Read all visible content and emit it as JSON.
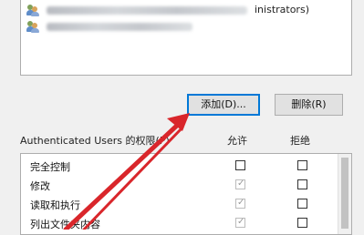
{
  "user_list": {
    "rows": [
      {
        "suffix": "inistrators)"
      },
      {
        "suffix": ""
      }
    ]
  },
  "buttons": {
    "add": "添加(D)...",
    "remove": "删除(R)"
  },
  "permissions": {
    "header_label": "Authenticated Users 的权限(P)",
    "allow_header": "允许",
    "deny_header": "拒绝",
    "rows": [
      {
        "label": "完全控制",
        "allow_checked": false,
        "allow_disabled": false,
        "deny_checked": false
      },
      {
        "label": "修改",
        "allow_checked": true,
        "allow_disabled": true,
        "deny_checked": false
      },
      {
        "label": "读取和执行",
        "allow_checked": true,
        "allow_disabled": true,
        "deny_checked": false
      },
      {
        "label": "列出文件夹内容",
        "allow_checked": true,
        "allow_disabled": true,
        "deny_checked": false
      }
    ]
  },
  "colors": {
    "annotation_arrow": "#d9262b",
    "focus_border": "#0078d7"
  },
  "icons": {
    "user_row_icon": "user-group-icon",
    "check_mark": "check-icon"
  }
}
